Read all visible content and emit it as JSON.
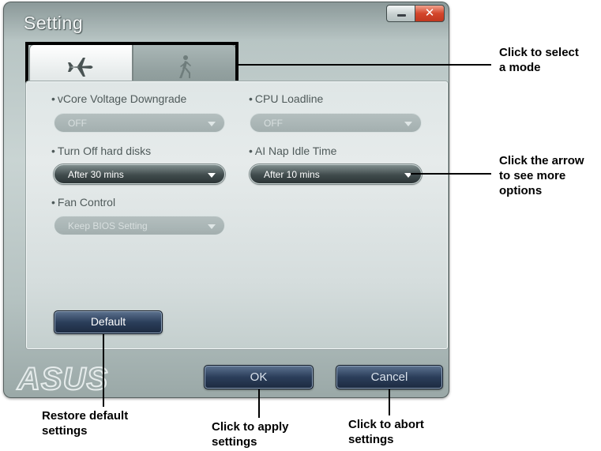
{
  "window": {
    "title": "Setting",
    "close_glyph": "✕",
    "logo_text": "ASUS"
  },
  "tabs": [
    {
      "icon": "airplane-icon",
      "selected": true
    },
    {
      "icon": "walking-person-icon",
      "selected": false
    }
  ],
  "fields": {
    "vcore": {
      "label": "vCore Voltage Downgrade",
      "value": "OFF",
      "enabled": false
    },
    "cpu_loadline": {
      "label": "CPU Loadline",
      "value": "OFF",
      "enabled": false
    },
    "hdd": {
      "label": "Turn Off hard disks",
      "value": "After 30 mins",
      "enabled": true
    },
    "ai_nap": {
      "label": "AI Nap Idle Time",
      "value": "After 10 mins",
      "enabled": true
    },
    "fan": {
      "label": "Fan Control",
      "value": "Keep BIOS Setting",
      "enabled": false
    }
  },
  "buttons": {
    "default": "Default",
    "ok": "OK",
    "cancel": "Cancel"
  },
  "annotations": {
    "select_mode": [
      "Click to select",
      "a mode"
    ],
    "arrow": [
      "Click the arrow",
      "to see more",
      "options"
    ],
    "restore": [
      "Restore default",
      "settings"
    ],
    "apply": [
      "Click to apply",
      "settings"
    ],
    "abort": [
      "Click to abort",
      "settings"
    ]
  },
  "colors": {
    "accent_button": "#2b3e5a",
    "window_frame": "#b8c5c4",
    "close_button": "#d4462b"
  }
}
